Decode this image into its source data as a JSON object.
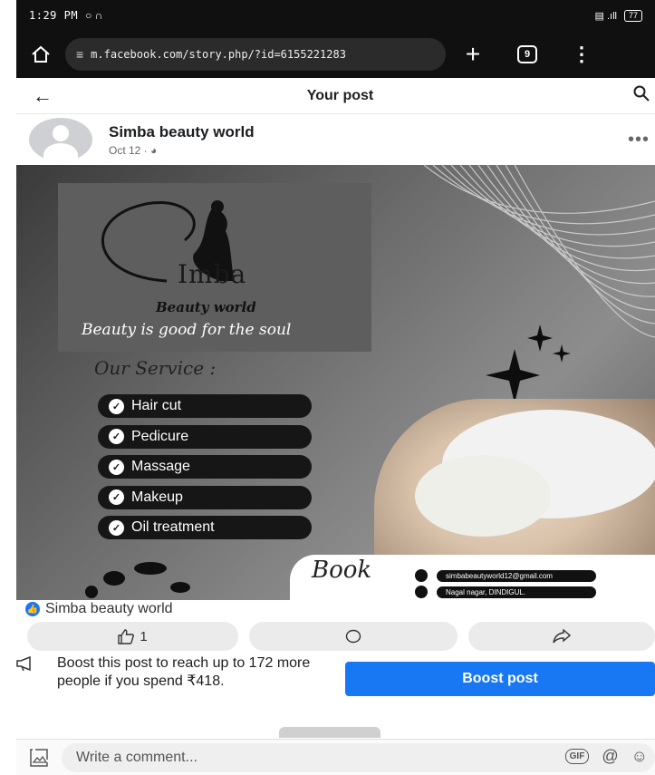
{
  "status_bar": {
    "time": "1:29 PM",
    "left_icons": "○ ∩",
    "battery": "77",
    "signal": "▤ .ıll"
  },
  "browser": {
    "url": "m.facebook.com/story.php/?id=6155221283",
    "tab_count": "9",
    "new_tab": "+",
    "menu": "⋮"
  },
  "header": {
    "title": "Your post",
    "back": "←",
    "search": "⚲"
  },
  "post": {
    "author": "Simba beauty world",
    "date": "Oct 12 ·",
    "more": "•••",
    "image": {
      "brand": "Imba",
      "brand_sub": "Beauty world",
      "tagline": "Beauty is good for the soul",
      "our_service": "Our Service :",
      "services": [
        "Hair cut",
        "Pedicure",
        "Massage",
        "Makeup",
        "Oil treatment"
      ],
      "book": "Book",
      "email": "simbabeautyworld12@gmail.com",
      "address": "Nagal nagar, DINDIGUL."
    }
  },
  "reactions": {
    "liker": "Simba beauty world",
    "like_count": "1"
  },
  "boost": {
    "text": "Boost this post to reach up to 172 more people if you spend ₹418.",
    "button": "Boost post"
  },
  "comment": {
    "placeholder": "Write a comment...",
    "gif": "GIF",
    "at": "@",
    "emoji": "☺"
  },
  "colors": {
    "accent": "#1877f2",
    "bar": "#101010"
  }
}
